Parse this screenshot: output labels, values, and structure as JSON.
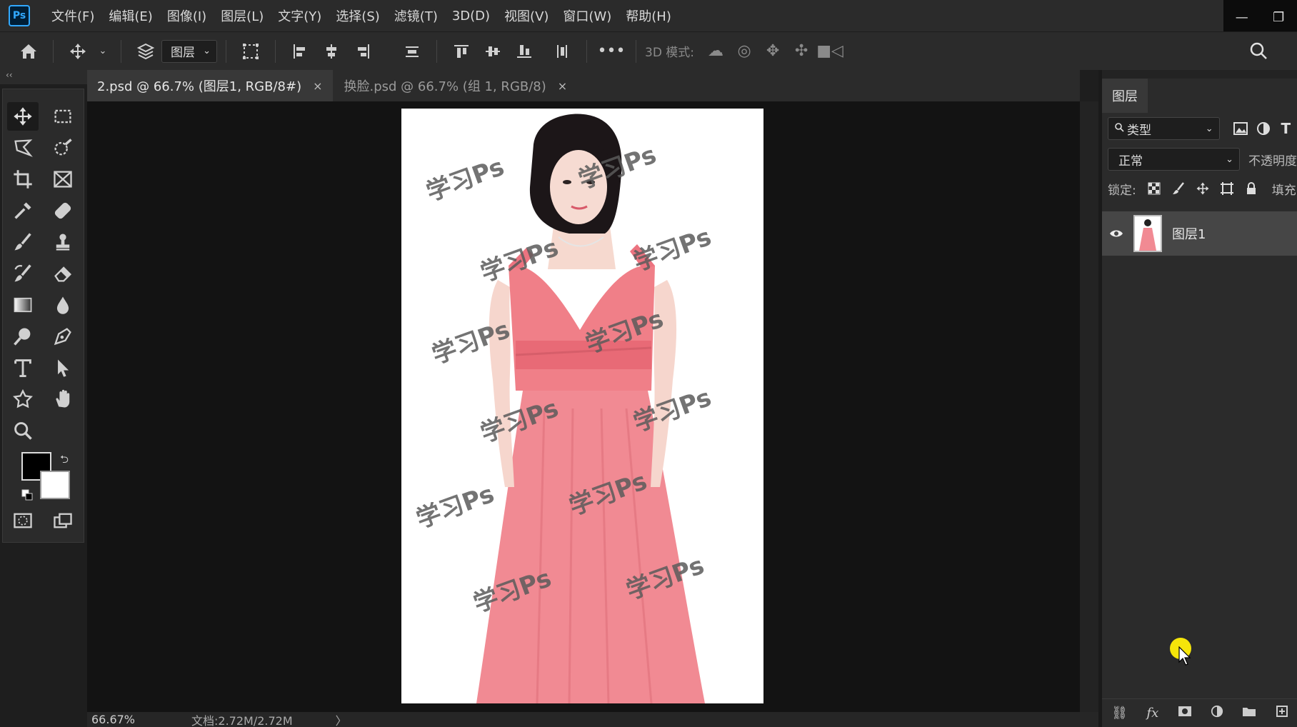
{
  "app": {
    "logo": "Ps",
    "menu": [
      "文件(F)",
      "编辑(E)",
      "图像(I)",
      "图层(L)",
      "文字(Y)",
      "选择(S)",
      "滤镜(T)",
      "3D(D)",
      "视图(V)",
      "窗口(W)",
      "帮助(H)"
    ],
    "window_controls": {
      "minimize": "—",
      "restore": "❐"
    }
  },
  "options_bar": {
    "layer_select": "图层",
    "mode3d_label": "3D 模式:"
  },
  "tabs": [
    {
      "label": "2.psd @ 66.7% (图层1, RGB/8#)",
      "close": "×"
    },
    {
      "label": "换脸.psd @ 66.7% (组 1, RGB/8)",
      "close": "×"
    }
  ],
  "canvas": {
    "watermark": "学习Ps"
  },
  "status": {
    "zoom": "66.67%",
    "doc_size": "文档:2.72M/2.72M",
    "arrow": "〉"
  },
  "layers_panel": {
    "tab": "图层",
    "filter_label": "类型",
    "blend_mode": "正常",
    "opacity_label": "不透明度",
    "lock_label": "锁定:",
    "fill_label": "填充",
    "layers": [
      {
        "name": "图层1",
        "visible": true
      }
    ]
  },
  "colors": {
    "accent": "#31a8ff",
    "foreground": "#000000",
    "background": "#ffffff",
    "dress": "#f0808a"
  }
}
